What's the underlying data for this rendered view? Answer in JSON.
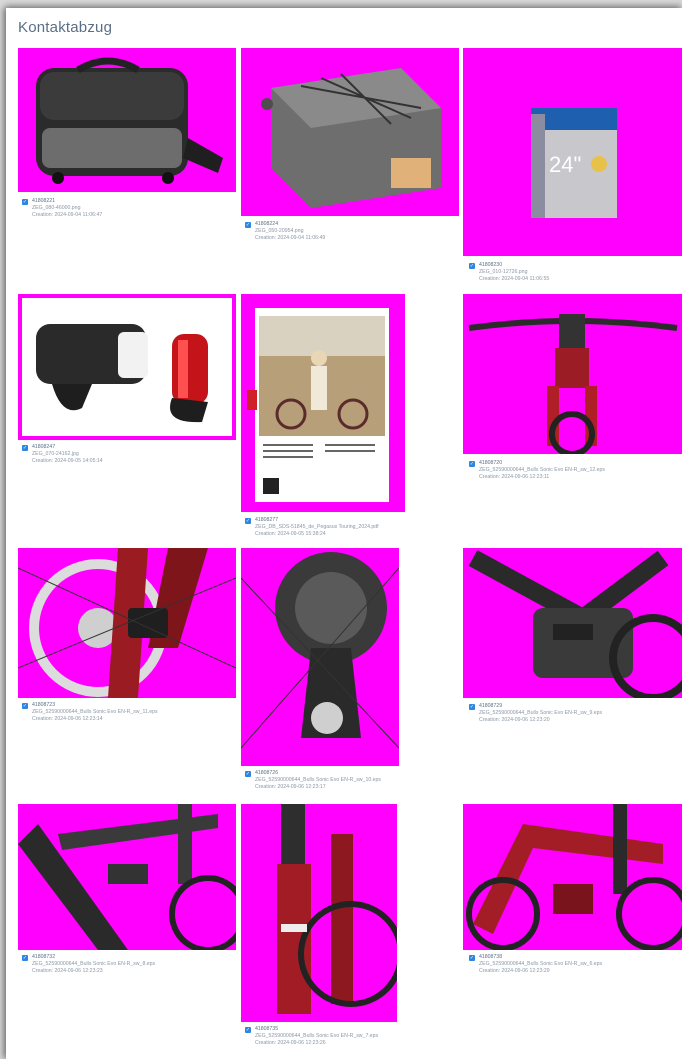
{
  "page": {
    "title": "Kontaktabzug"
  },
  "items": [
    {
      "id": "41808221",
      "file": "ZEG_080-46000.png",
      "created": "Creation: 2024-09-04 11:06:47",
      "subject": "handlebar bag"
    },
    {
      "id": "41808224",
      "file": "ZEG_050-20954.png",
      "created": "Creation: 2024-09-04 11:06:49",
      "subject": "carrier bag"
    },
    {
      "id": "41808230",
      "file": "ZEG_010-12726.png",
      "created": "Creation: 2024-09-04 11:06:55",
      "subject": "inner tube box",
      "box_text": "24\""
    },
    {
      "id": "41808247",
      "file": "ZEG_070-24162.jpg",
      "created": "Creation: 2024-09-05 14:05:14",
      "subject": "bike light set"
    },
    {
      "id": "41808277",
      "file": "ZEG_DB_SDS-51845_de_Pegasus Touring_2024.pdf",
      "created": "Creation: 2024-09-05 15:38:24",
      "subject": "brochure page"
    },
    {
      "id": "41808720",
      "file": "ZEG_52590000644_Bulls Sonic Evo EN-R_sw_12.eps",
      "created": "Creation: 2024-09-06 12:23:11",
      "subject": "handlebar and fork"
    },
    {
      "id": "41808723",
      "file": "ZEG_52590000644_Bulls Sonic Evo EN-R_sw_11.eps",
      "created": "Creation: 2024-09-06 12:23:14",
      "subject": "disc brake"
    },
    {
      "id": "41808726",
      "file": "ZEG_52590000644_Bulls Sonic Evo EN-R_sw_10.eps",
      "created": "Creation: 2024-09-06 12:23:17",
      "subject": "rear derailleur"
    },
    {
      "id": "41808729",
      "file": "ZEG_52590000644_Bulls Sonic Evo EN-R_sw_9.eps",
      "created": "Creation: 2024-09-06 12:23:20",
      "subject": "motor unit"
    },
    {
      "id": "41808732",
      "file": "ZEG_52590000644_Bulls Sonic Evo EN-R_sw_8.eps",
      "created": "Creation: 2024-09-06 12:23:23",
      "subject": "frame top tube"
    },
    {
      "id": "41808735",
      "file": "ZEG_52590000644_Bulls Sonic Evo EN-R_sw_7.eps",
      "created": "Creation: 2024-09-06 12:23:26",
      "subject": "suspension fork"
    },
    {
      "id": "41808738",
      "file": "ZEG_52590000644_Bulls Sonic Evo EN-R_sw_6.eps",
      "created": "Creation: 2024-09-06 12:23:29",
      "subject": "red frame detail"
    }
  ],
  "colors": {
    "background": "#ff00ff",
    "accent": "#2e86de",
    "title": "#5a6f86"
  }
}
